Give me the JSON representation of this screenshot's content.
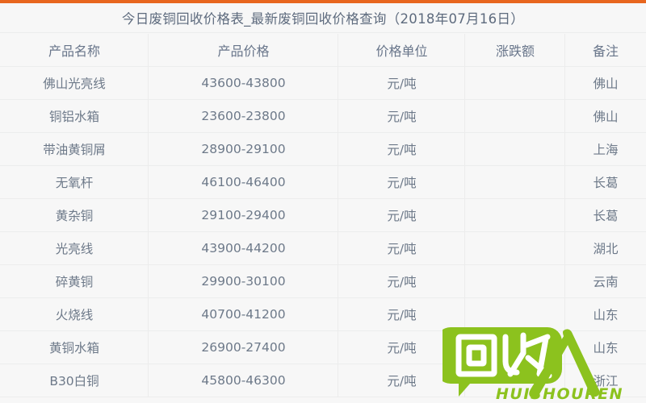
{
  "page": {
    "title": "今日废铜回收价格表_最新废铜回收价格查询（2018年07月16日）",
    "accent_orange": "#e8661e",
    "background": "#f7f7f7",
    "text_color": "#6d7989"
  },
  "table": {
    "columns": [
      {
        "key": "name",
        "label": "产品名称"
      },
      {
        "key": "price",
        "label": "产品价格"
      },
      {
        "key": "unit",
        "label": "价格单位"
      },
      {
        "key": "change",
        "label": "涨跌额"
      },
      {
        "key": "note",
        "label": "备注"
      }
    ],
    "rows": [
      {
        "name": "佛山光亮线",
        "price": "43600-43800",
        "unit": "元/吨",
        "change": "",
        "note": "佛山"
      },
      {
        "name": "铜铝水箱",
        "price": "23600-23800",
        "unit": "元/吨",
        "change": "",
        "note": "佛山"
      },
      {
        "name": "带油黄铜屑",
        "price": "28900-29100",
        "unit": "元/吨",
        "change": "",
        "note": "上海"
      },
      {
        "name": "无氧杆",
        "price": "46100-46400",
        "unit": "元/吨",
        "change": "",
        "note": "长葛"
      },
      {
        "name": "黄杂铜",
        "price": "29100-29400",
        "unit": "元/吨",
        "change": "",
        "note": "长葛"
      },
      {
        "name": "光亮线",
        "price": "43900-44200",
        "unit": "元/吨",
        "change": "",
        "note": "湖北"
      },
      {
        "name": "碎黄铜",
        "price": "29900-30100",
        "unit": "元/吨",
        "change": "",
        "note": "云南"
      },
      {
        "name": "火烧线",
        "price": "40700-41200",
        "unit": "元/吨",
        "change": "",
        "note": "山东"
      },
      {
        "name": "黄铜水箱",
        "price": "26900-27400",
        "unit": "元/吨",
        "change": "",
        "note": "山东"
      },
      {
        "name": "B30白铜",
        "price": "45800-46300",
        "unit": "元/吨",
        "change": "",
        "note": "浙江"
      }
    ]
  },
  "watermark": {
    "logo_text": "回收",
    "person_glyph": "人",
    "romanization": "HUISHOUREN",
    "color": "#8cc21e"
  }
}
